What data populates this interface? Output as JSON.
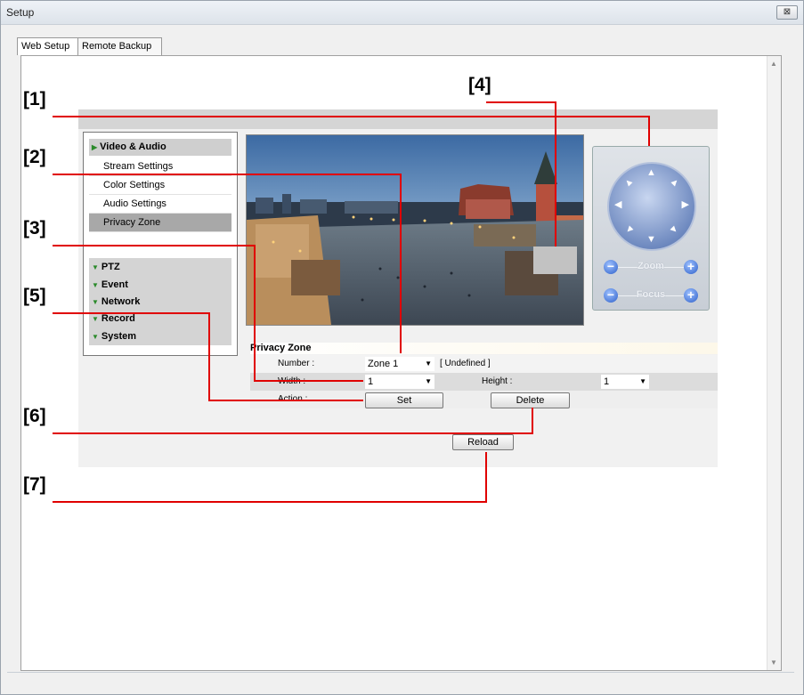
{
  "window": {
    "title": "Setup",
    "close_glyph": "⊠"
  },
  "tabs": [
    {
      "label": "Web Setup"
    },
    {
      "label": "Remote Backup"
    }
  ],
  "menu": {
    "video_audio": {
      "label": "Video & Audio"
    },
    "items": [
      {
        "label": "Stream Settings"
      },
      {
        "label": "Color Settings"
      },
      {
        "label": "Audio Settings"
      },
      {
        "label": "Privacy Zone"
      }
    ],
    "groups": [
      {
        "label": "PTZ"
      },
      {
        "label": "Event"
      },
      {
        "label": "Network"
      },
      {
        "label": "Record"
      },
      {
        "label": "System"
      }
    ]
  },
  "ptz": {
    "zoom_label": "Zoom",
    "focus_label": "Focus"
  },
  "privacy_zone": {
    "title": "Privacy Zone",
    "number_label": "Number :",
    "number_value": "Zone 1",
    "number_status": "[ Undefined ]",
    "width_label": "Width :",
    "width_value": "1",
    "height_label": "Height :",
    "height_value": "1",
    "action_label": "Action :",
    "set_button": "Set",
    "delete_button": "Delete",
    "reload_button": "Reload"
  },
  "callouts": {
    "c1": "[1]",
    "c2": "[2]",
    "c3": "[3]",
    "c4": "[4]",
    "c5": "[5]",
    "c6": "[6]",
    "c7": "[7]"
  },
  "colors": {
    "callout_line": "#e00000",
    "menu_arrow": "#2a8a2a"
  }
}
